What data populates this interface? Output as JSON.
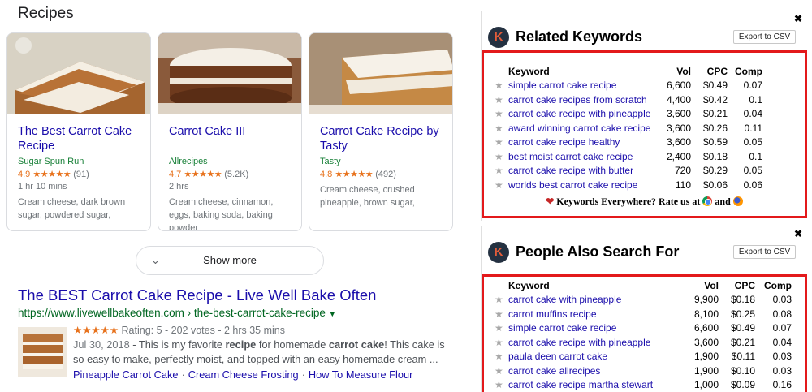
{
  "recipes": {
    "heading": "Recipes",
    "cards": [
      {
        "title": "The Best Carrot Cake Recipe",
        "source": "Sugar Spun Run",
        "rating": "4.9",
        "stars": "★★★★★",
        "reviews": "(91)",
        "time": "1 hr 10 mins",
        "description": "Cream cheese, dark brown sugar, powdered sugar,"
      },
      {
        "title": "Carrot Cake III",
        "source": "Allrecipes",
        "rating": "4.7",
        "stars": "★★★★★",
        "reviews": "(5.2K)",
        "time": "2 hrs",
        "description": "Cream cheese, cinnamon, eggs, baking soda, baking powder"
      },
      {
        "title": "Carrot Cake Recipe by Tasty",
        "source": "Tasty",
        "rating": "4.8",
        "stars": "★★★★★",
        "reviews": "(492)",
        "time": "",
        "description": "Cream cheese, crushed pineapple, brown sugar,"
      }
    ],
    "show_more_label": "Show more"
  },
  "result": {
    "title": "The BEST Carrot Cake Recipe - Live Well Bake Often",
    "url": "https://www.livewellbakeoften.com › the-best-carrot-cake-recipe",
    "stars": "★★★★★",
    "rating_text": "Rating: 5 - 202 votes - 2 hrs 35 mins",
    "date": "Jul 30, 2018",
    "snippet_1": " - This is my favorite ",
    "snippet_b1": "recipe",
    "snippet_2": " for homemade ",
    "snippet_b2": "carrot cake",
    "snippet_3": "! This cake is so easy to make, perfectly moist, and topped with an easy homemade cream ...",
    "sitelinks": [
      "Pineapple Carrot Cake",
      "Cream Cheese Frosting",
      "How To Measure Flour"
    ],
    "sitelink_separator": "·"
  },
  "related_keywords": {
    "title": "Related Keywords",
    "export_label": "Export to CSV",
    "close_label": "✖",
    "logo_letter": "K",
    "columns": [
      "Keyword",
      "Vol",
      "CPC",
      "Comp"
    ],
    "rows": [
      {
        "keyword": "simple carrot cake recipe",
        "vol": "6,600",
        "cpc": "$0.49",
        "comp": "0.07"
      },
      {
        "keyword": "carrot cake recipes from scratch",
        "vol": "4,400",
        "cpc": "$0.42",
        "comp": "0.1"
      },
      {
        "keyword": "carrot cake recipe with pineapple",
        "vol": "3,600",
        "cpc": "$0.21",
        "comp": "0.04"
      },
      {
        "keyword": "award winning carrot cake recipe",
        "vol": "3,600",
        "cpc": "$0.26",
        "comp": "0.11"
      },
      {
        "keyword": "carrot cake recipe healthy",
        "vol": "3,600",
        "cpc": "$0.59",
        "comp": "0.05"
      },
      {
        "keyword": "best moist carrot cake recipe",
        "vol": "2,400",
        "cpc": "$0.18",
        "comp": "0.1"
      },
      {
        "keyword": "carrot cake recipe with butter",
        "vol": "720",
        "cpc": "$0.29",
        "comp": "0.05"
      },
      {
        "keyword": "worlds best carrot cake recipe",
        "vol": "110",
        "cpc": "$0.06",
        "comp": "0.06"
      }
    ],
    "rate_prefix": "Keywords Everywhere? Rate us at",
    "rate_and": "and"
  },
  "people_also_search": {
    "title": "People Also Search For",
    "export_label": "Export to CSV",
    "close_label": "✖",
    "logo_letter": "K",
    "columns": [
      "Keyword",
      "Vol",
      "CPC",
      "Comp"
    ],
    "rows": [
      {
        "keyword": "carrot cake with pineapple",
        "vol": "9,900",
        "cpc": "$0.18",
        "comp": "0.03"
      },
      {
        "keyword": "carrot muffins recipe",
        "vol": "8,100",
        "cpc": "$0.25",
        "comp": "0.08"
      },
      {
        "keyword": "simple carrot cake recipe",
        "vol": "6,600",
        "cpc": "$0.49",
        "comp": "0.07"
      },
      {
        "keyword": "carrot cake recipe with pineapple",
        "vol": "3,600",
        "cpc": "$0.21",
        "comp": "0.04"
      },
      {
        "keyword": "paula deen carrot cake",
        "vol": "1,900",
        "cpc": "$0.11",
        "comp": "0.03"
      },
      {
        "keyword": "carrot cake allrecipes",
        "vol": "1,900",
        "cpc": "$0.10",
        "comp": "0.03"
      },
      {
        "keyword": "carrot cake recipe martha stewart",
        "vol": "1,000",
        "cpc": "$0.09",
        "comp": "0.16"
      }
    ]
  },
  "colors": {
    "link": "#1a0dab",
    "url_green": "#006621",
    "star_orange": "#e7711b",
    "highlight_red": "#e3191b"
  }
}
